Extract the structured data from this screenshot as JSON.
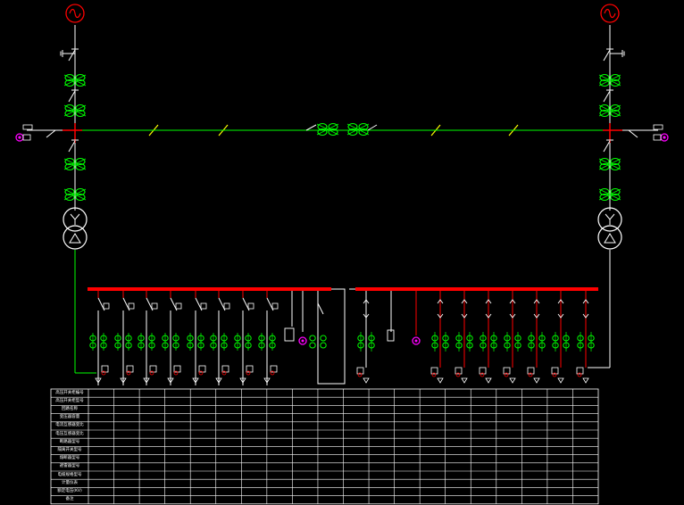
{
  "colors": {
    "background": "#000000",
    "bus_red": "#ff0000",
    "line_green": "#00ff00",
    "line_white": "#ffffff",
    "symbol_green": "#00ff00",
    "symbol_magenta": "#ff00ff",
    "symbol_yellow": "#ffff00",
    "generator_red": "#ff0000"
  },
  "icons": {
    "generator": "generator-icon",
    "current_transformer": "current-transformer-icon",
    "transformer": "transformer-icon",
    "breaker": "breaker-icon",
    "surge_arrester": "surge-arrester-icon",
    "earthing_switch": "earthing-switch-icon"
  },
  "table": {
    "row_labels": [
      "高压开关柜编号",
      "高压开关柜型号",
      "回路名称",
      "变压器容量",
      "电流互感器变比",
      "电压互感器变比",
      "断路器型号",
      "隔离开关型号",
      "熔断器型号",
      "避雷器型号",
      "电缆规格型号",
      "计量仪表",
      "额定电压(KV)",
      "备注"
    ],
    "column_count": 20
  }
}
